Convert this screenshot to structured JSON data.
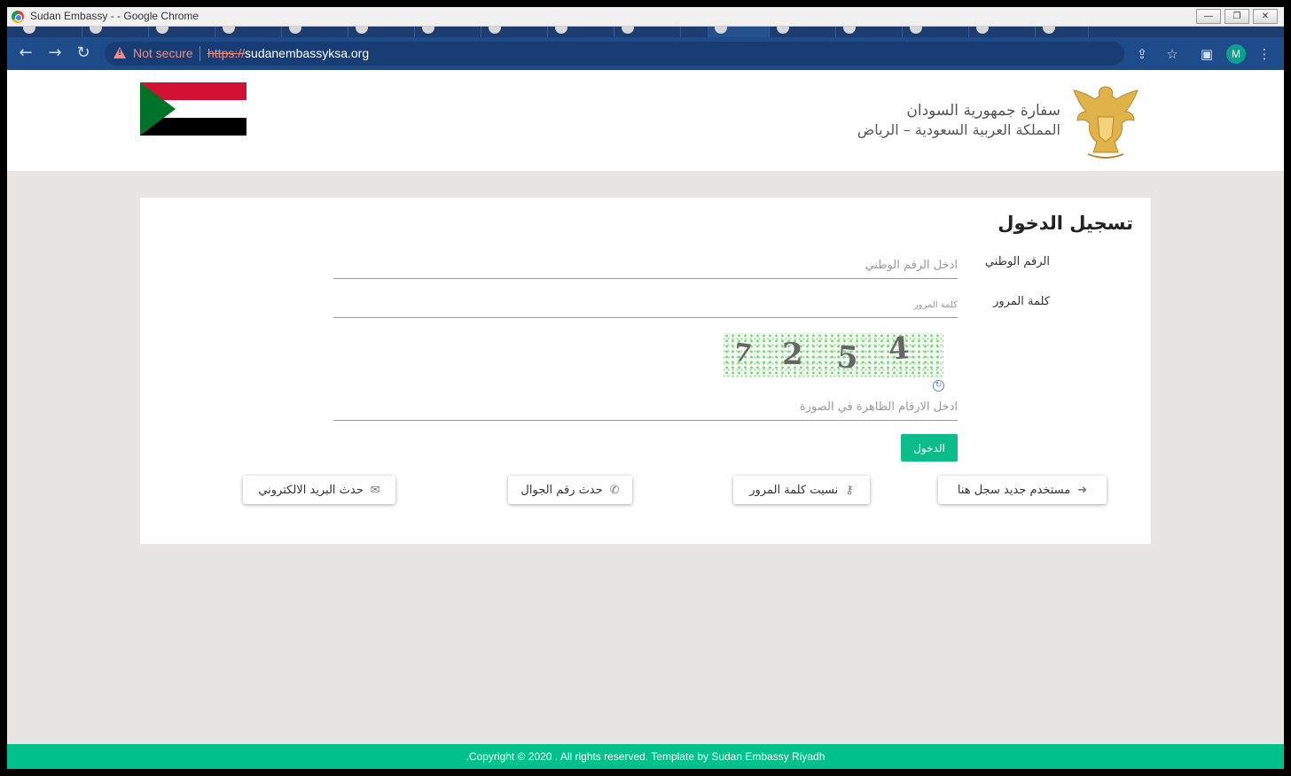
{
  "window": {
    "title": "Sudan Embassy - - Google Chrome",
    "minimize": "—",
    "maximize": "❐",
    "close": "✕"
  },
  "browser": {
    "security_label": "Not secure",
    "url_protocol": "https://",
    "url_host": "sudanembassyksa.org",
    "avatar_initial": "M"
  },
  "header": {
    "embassy_line1": "سفارة جمهورية السودان",
    "embassy_line2": "المملكة العربية السعودية – الرياض"
  },
  "login": {
    "title": "تسجيل الدخول",
    "national_id_label": "الرقم الوطني",
    "national_id_placeholder": "ادخل الرقم الوطني",
    "national_id_value": "",
    "password_label": "كلمة المرور",
    "password_placeholder": "كلمة المرور",
    "password_value": "",
    "captcha_digits": [
      "7",
      "2",
      "5",
      "4"
    ],
    "captcha_placeholder": "ادخل الارقام الظاهرة في الصورة",
    "captcha_value": "",
    "submit_label": "الدخول"
  },
  "links": {
    "register": "مستخدم جديد سجل هنا",
    "forgot_password": "نسيت كلمة المرور",
    "update_mobile": "حدث رقم الجوال",
    "update_email": "حدث البريد الالكتروني"
  },
  "footer": {
    "copyright": ".Copyright © 2020 . All rights reserved. Template by Sudan Embassy Riyadh"
  },
  "colors": {
    "primary": "#0cbc8a",
    "footer": "#00c08b",
    "browser_toolbar": "#1e4b8a"
  }
}
